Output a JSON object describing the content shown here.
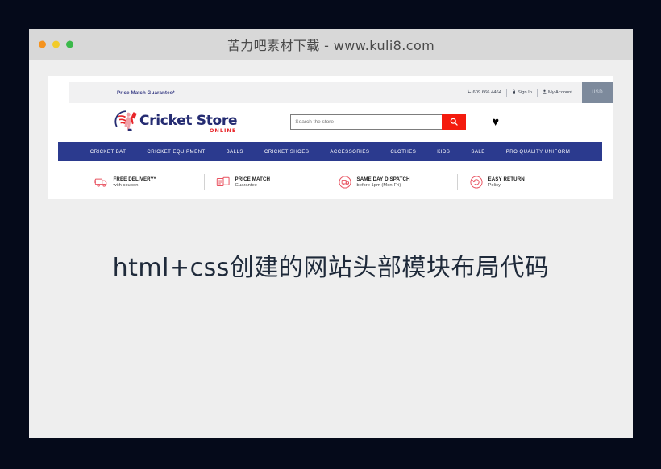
{
  "window": {
    "title": "苦力吧素材下载 - www.kuli8.com",
    "traffic_lights": [
      {
        "name": "close",
        "color": "#f5931e"
      },
      {
        "name": "minimize",
        "color": "#f2cb2a"
      },
      {
        "name": "maximize",
        "color": "#3bb94a"
      }
    ]
  },
  "site": {
    "utility_bar": {
      "price_match": "Price Match Guarantee*",
      "phone": "609.666.4464",
      "sign_in": "Sign In",
      "my_account": "My Account",
      "currency": "USD",
      "phone_icon": "phone-icon",
      "sign_in_icon": "lock-icon",
      "account_icon": "user-icon"
    },
    "logo": {
      "title": "Cricket Store",
      "subtitle": "ONLINE",
      "title_color": "#252c72",
      "subtitle_color": "#e8262a",
      "mark_icon": "cricket-player-icon"
    },
    "search": {
      "placeholder": "Search the store",
      "value": "",
      "button_icon": "search-icon",
      "button_color": "#f41b0e"
    },
    "wishlist": {
      "icon": "heart-icon",
      "glyph": "♥"
    },
    "nav": {
      "background": "#2b3a8e",
      "items": [
        {
          "label": "CRICKET BAT",
          "name": "nav-item-cricket-bat"
        },
        {
          "label": "CRICKET EQUIPMENT",
          "name": "nav-item-cricket-equipment"
        },
        {
          "label": "BALLS",
          "name": "nav-item-balls"
        },
        {
          "label": "CRICKET SHOES",
          "name": "nav-item-cricket-shoes"
        },
        {
          "label": "ACCESSORIES",
          "name": "nav-item-accessories"
        },
        {
          "label": "CLOTHES",
          "name": "nav-item-clothes"
        },
        {
          "label": "KIDS",
          "name": "nav-item-kids"
        },
        {
          "label": "SALE",
          "name": "nav-item-sale"
        },
        {
          "label": "PRO QUALITY UNIFORM",
          "name": "nav-item-pro-quality-uniform"
        }
      ]
    },
    "features": [
      {
        "title": "FREE DELIVERY*",
        "sub": "with coupon",
        "icon": "delivery-truck-icon"
      },
      {
        "title": "PRICE MATCH",
        "sub": "Guarantee",
        "icon": "price-tags-icon"
      },
      {
        "title": "SAME DAY DISPATCH",
        "sub": "before 1pm (Mon-Fri)",
        "icon": "same-day-dispatch-icon"
      },
      {
        "title": "EASY RETURN",
        "sub": "Policy",
        "icon": "return-arrow-icon"
      }
    ],
    "accent_color": "#f41b0e"
  },
  "caption": {
    "text": "html+css创建的网站头部模块布局代码"
  }
}
